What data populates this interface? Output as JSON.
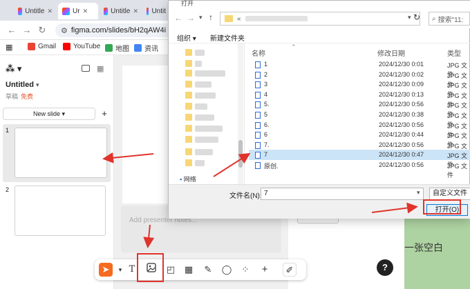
{
  "browser": {
    "tabs": [
      {
        "label": "Untitle",
        "active": false
      },
      {
        "label": "Ur",
        "active": true
      },
      {
        "label": "Untitle",
        "active": false
      },
      {
        "label": "Untit",
        "active": false
      }
    ],
    "url": "figma.com/slides/bH2qAW4i"
  },
  "bookmarks": [
    {
      "label": "Gmail",
      "color": "#ea4335"
    },
    {
      "label": "YouTube",
      "color": "#ff0000"
    },
    {
      "label": "地图",
      "color": "#34a853"
    },
    {
      "label": "资讯",
      "color": "#4285f4"
    }
  ],
  "figma": {
    "file_name": "Untitled",
    "file_sub": "草稿",
    "plan_badge": "免费",
    "new_slide": "New slide",
    "slides": [
      "1",
      "2"
    ],
    "notes_placeholder": "Add presenter notes...",
    "canvas_text": "一张空白",
    "help": "?"
  },
  "dialog": {
    "title": "打开",
    "search_placeholder": "搜索\"11:",
    "organize": "组织 ▾",
    "new_folder": "新建文件夹",
    "nav_bottom": "网络",
    "columns": {
      "name": "名称",
      "date": "修改日期",
      "type": "类型"
    },
    "files": [
      {
        "name": "1",
        "date": "2024/12/30 0:01",
        "type": "JPG 文件",
        "selected": false
      },
      {
        "name": "2",
        "date": "2024/12/30 0:02",
        "type": "JPG 文件",
        "selected": false
      },
      {
        "name": "3",
        "date": "2024/12/30 0:09",
        "type": "JPG 文件",
        "selected": false
      },
      {
        "name": "4",
        "date": "2024/12/30 0:13",
        "type": "JPG 文件",
        "selected": false
      },
      {
        "name": "5.",
        "date": "2024/12/30 0:56",
        "type": "JPG 文件",
        "selected": false
      },
      {
        "name": "5",
        "date": "2024/12/30 0:38",
        "type": "JPG 文件",
        "selected": false
      },
      {
        "name": "6.",
        "date": "2024/12/30 0:56",
        "type": "JPG 文件",
        "selected": false
      },
      {
        "name": "6",
        "date": "2024/12/30 0:44",
        "type": "JPG 文件",
        "selected": false
      },
      {
        "name": "7.",
        "date": "2024/12/30 0:56",
        "type": "JPG 文件",
        "selected": false
      },
      {
        "name": "7",
        "date": "2024/12/30 0:47",
        "type": "JPG 文件",
        "selected": true
      },
      {
        "name": "原创.",
        "date": "2024/12/30 0:56",
        "type": "JPG 文件",
        "selected": false
      }
    ],
    "filename_label": "文件名(N):",
    "filename_value": "7",
    "filetype": "自定义文件",
    "open_button": "打开(O)"
  },
  "colors": {
    "annotation_red": "#e0332b",
    "figma_select": "#f56b1f"
  }
}
